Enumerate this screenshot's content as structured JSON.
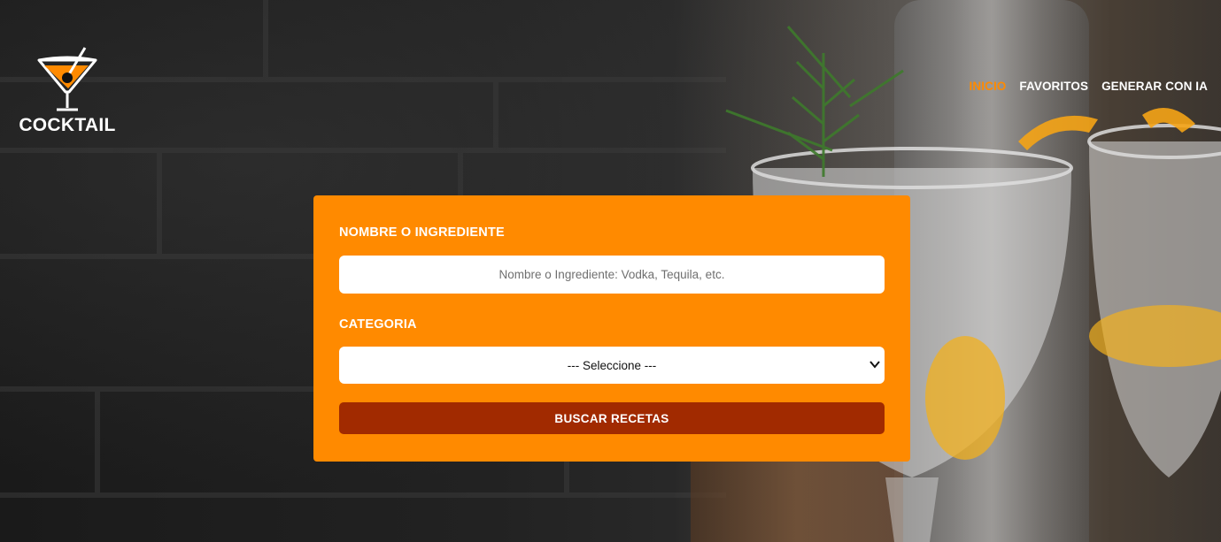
{
  "brand": {
    "name": "COCKTAIL",
    "logo_icon": "cocktail-glass-icon"
  },
  "nav": {
    "items": [
      {
        "label": "INICIO",
        "active": true
      },
      {
        "label": "FAVORITOS",
        "active": false
      },
      {
        "label": "GENERAR CON IA",
        "active": false
      }
    ]
  },
  "search_form": {
    "name_label": "NOMBRE O INGREDIENTE",
    "name_placeholder": "Nombre o Ingrediente: Vodka, Tequila, etc.",
    "name_value": "",
    "category_label": "CATEGORIA",
    "category_selected": "--- Seleccione ---",
    "submit_label": "BUSCAR RECETAS"
  },
  "colors": {
    "accent": "#ff8a00",
    "button": "#a12a00",
    "text_light": "#ffffff"
  }
}
